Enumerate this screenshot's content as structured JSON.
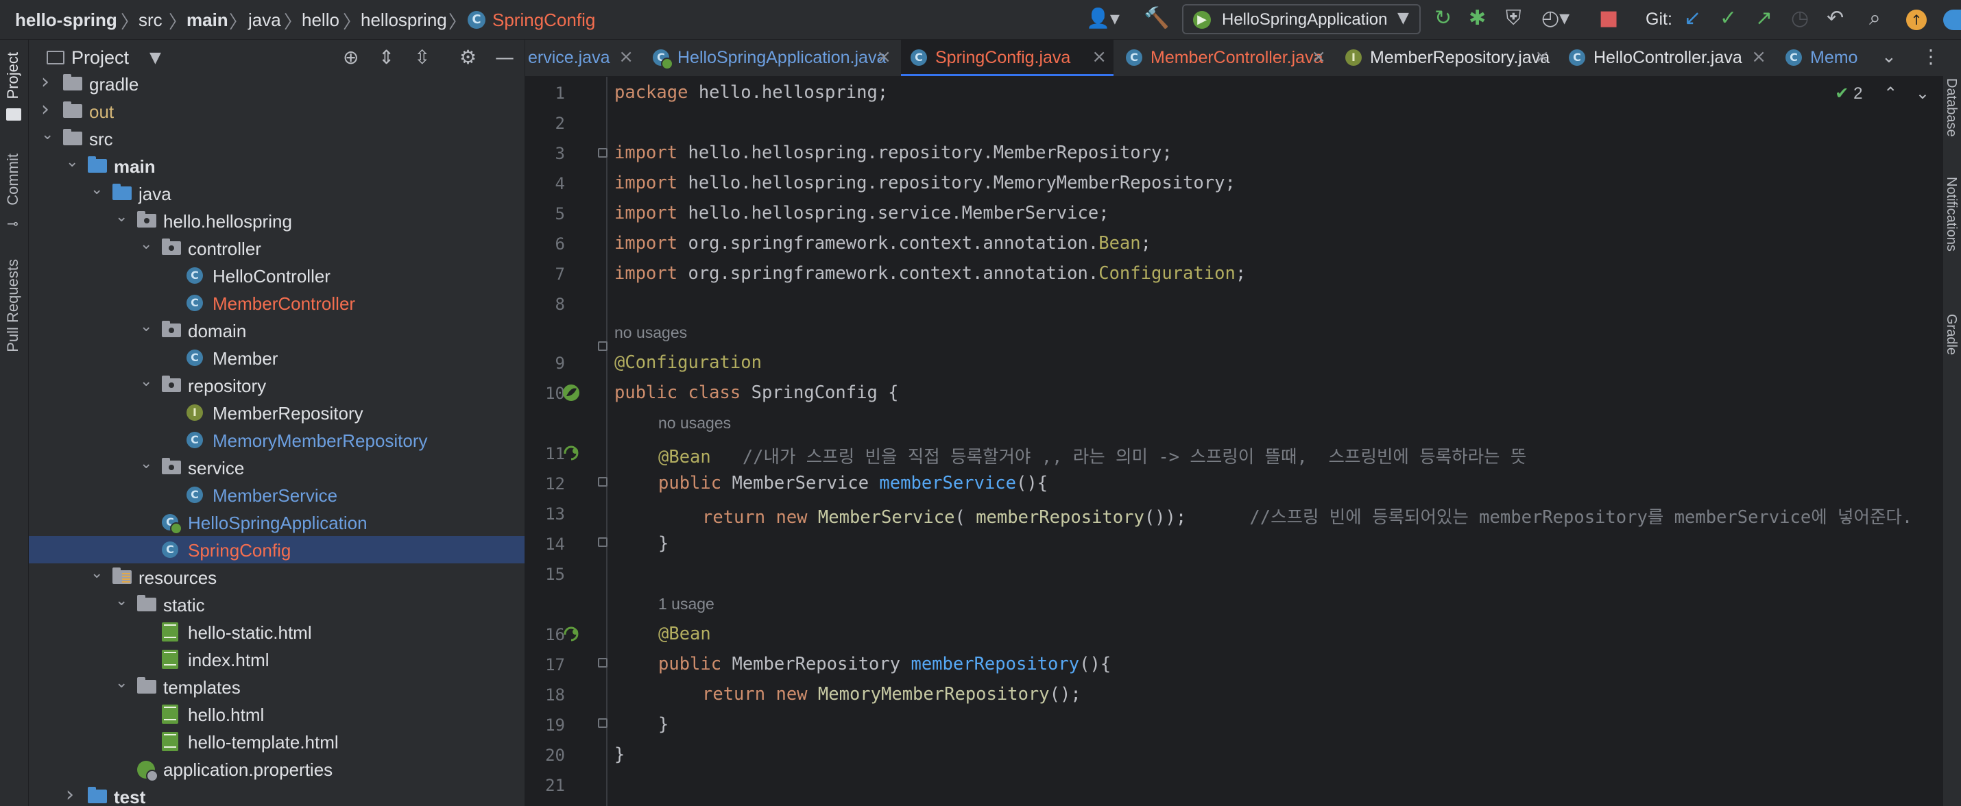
{
  "breadcrumb": [
    "hello-spring",
    "src",
    "main",
    "java",
    "hello",
    "hellospring",
    "SpringConfig"
  ],
  "run_config": "HelloSpringApplication",
  "git_label": "Git:",
  "left_strip": {
    "project": "Project",
    "commit": "Commit",
    "pull_requests": "Pull Requests"
  },
  "project_panel": {
    "title": "Project",
    "tree": [
      {
        "label": "gradle",
        "kind": "folder",
        "depth": 1,
        "chevron": "right",
        "color": "#dfe1e5"
      },
      {
        "label": "out",
        "kind": "folder",
        "depth": 1,
        "chevron": "right",
        "color": "#d5b778"
      },
      {
        "label": "src",
        "kind": "folder",
        "depth": 1,
        "chevron": "down",
        "color": "#dfe1e5"
      },
      {
        "label": "main",
        "kind": "module",
        "depth": 2,
        "chevron": "down",
        "color": "#dfe1e5",
        "bold": true
      },
      {
        "label": "java",
        "kind": "src-folder",
        "depth": 3,
        "chevron": "down",
        "color": "#dfe1e5"
      },
      {
        "label": "hello.hellospring",
        "kind": "package",
        "depth": 4,
        "chevron": "down",
        "color": "#dfe1e5"
      },
      {
        "label": "controller",
        "kind": "package",
        "depth": 5,
        "chevron": "down",
        "color": "#dfe1e5"
      },
      {
        "label": "HelloController",
        "kind": "class",
        "depth": 6,
        "color": "#dfe1e5"
      },
      {
        "label": "MemberController",
        "kind": "class",
        "depth": 6,
        "color": "#f46e4f"
      },
      {
        "label": "domain",
        "kind": "package",
        "depth": 5,
        "chevron": "down",
        "color": "#dfe1e5"
      },
      {
        "label": "Member",
        "kind": "class",
        "depth": 6,
        "color": "#dfe1e5"
      },
      {
        "label": "repository",
        "kind": "package",
        "depth": 5,
        "chevron": "down",
        "color": "#dfe1e5"
      },
      {
        "label": "MemberRepository",
        "kind": "interface",
        "depth": 6,
        "color": "#dfe1e5"
      },
      {
        "label": "MemoryMemberRepository",
        "kind": "class",
        "depth": 6,
        "color": "#6c9fe0"
      },
      {
        "label": "service",
        "kind": "package",
        "depth": 5,
        "chevron": "down",
        "color": "#dfe1e5"
      },
      {
        "label": "MemberService",
        "kind": "class",
        "depth": 6,
        "color": "#6c9fe0"
      },
      {
        "label": "HelloSpringApplication",
        "kind": "spring-class",
        "depth": 5,
        "color": "#6c9fe0"
      },
      {
        "label": "SpringConfig",
        "kind": "class",
        "depth": 5,
        "color": "#f46e4f",
        "selected": true
      },
      {
        "label": "resources",
        "kind": "res-folder",
        "depth": 3,
        "chevron": "down",
        "color": "#dfe1e5"
      },
      {
        "label": "static",
        "kind": "folder",
        "depth": 4,
        "chevron": "down",
        "color": "#dfe1e5"
      },
      {
        "label": "hello-static.html",
        "kind": "html",
        "depth": 5,
        "color": "#dfe1e5"
      },
      {
        "label": "index.html",
        "kind": "html",
        "depth": 5,
        "color": "#dfe1e5"
      },
      {
        "label": "templates",
        "kind": "folder",
        "depth": 4,
        "chevron": "down",
        "color": "#dfe1e5"
      },
      {
        "label": "hello.html",
        "kind": "html",
        "depth": 5,
        "color": "#dfe1e5"
      },
      {
        "label": "hello-template.html",
        "kind": "html",
        "depth": 5,
        "color": "#dfe1e5"
      },
      {
        "label": "application.properties",
        "kind": "properties",
        "depth": 4,
        "color": "#dfe1e5"
      },
      {
        "label": "test",
        "kind": "module",
        "depth": 2,
        "chevron": "right",
        "color": "#dfe1e5",
        "bold": true
      }
    ]
  },
  "tabs": [
    {
      "label": "ervice.java",
      "icon": "none",
      "color": "#6c9fe0",
      "active": false
    },
    {
      "label": "HelloSpringApplication.java",
      "icon": "spring-class",
      "color": "#6c9fe0",
      "active": false
    },
    {
      "label": "SpringConfig.java",
      "icon": "class",
      "color": "#f46e4f",
      "active": true
    },
    {
      "label": "MemberController.java",
      "icon": "class",
      "color": "#f46e4f",
      "active": false
    },
    {
      "label": "MemberRepository.java",
      "icon": "interface",
      "color": "#dfe1e5",
      "active": false
    },
    {
      "label": "HelloController.java",
      "icon": "class",
      "color": "#dfe1e5",
      "active": false
    },
    {
      "label": "Memo",
      "icon": "class",
      "color": "#6c9fe0",
      "active": false
    }
  ],
  "editor": {
    "inspection_count": "2",
    "lines": [
      "1",
      "2",
      "3",
      "4",
      "5",
      "6",
      "7",
      "8",
      "9",
      "10",
      "11",
      "12",
      "13",
      "14",
      "15",
      "16",
      "17",
      "18",
      "19",
      "20",
      "21"
    ],
    "hints": {
      "class_usages": "no usages",
      "member_service_usages": "no usages",
      "member_repository_usages": "1 usage"
    },
    "code": {
      "l1_kw": "package",
      "l1_rest": " hello.hellospring;",
      "l3_kw": "import",
      "l3_rest": " hello.hellospring.repository.MemberRepository;",
      "l4_kw": "import",
      "l4_rest": " hello.hellospring.repository.MemoryMemberRepository;",
      "l5_kw": "import",
      "l5_rest": " hello.hellospring.service.MemberService;",
      "l6_kw": "import",
      "l6_pre": " org.springframework.context.annotation.",
      "l6_cls": "Bean",
      "l6_end": ";",
      "l7_kw": "import",
      "l7_pre": " org.springframework.context.annotation.",
      "l7_cls": "Configuration",
      "l7_end": ";",
      "l9_ann": "@Configuration",
      "l10_kw": "public class",
      "l10_rest": " SpringConfig {",
      "l11_ann": "@Bean",
      "l11_cmt": "   //내가 스프링 빈을 직접 등록할거야 ,, 라는 의미 -> 스프링이 뜰때,  스프링빈에 등록하라는 뜻",
      "l12_kw": "public",
      "l12_type": " MemberService ",
      "l12_fn": "memberService",
      "l12_end": "(){",
      "l13_kw": "return new",
      "l13_type": " MemberService",
      "l13_mid": "( ",
      "l13_fn": "memberRepository",
      "l13_end": "());",
      "l13_cmt": "      //스프링 빈에 등록되어있는 memberRepository를 memberService에 넣어준다.",
      "l14": "}",
      "l16_ann": "@Bean",
      "l17_kw": "public",
      "l17_type": " MemberRepository ",
      "l17_fn": "memberRepository",
      "l17_end": "(){",
      "l18_kw": "return new",
      "l18_type": " MemoryMemberRepository",
      "l18_end": "();",
      "l19": "}",
      "l20": "}"
    }
  },
  "right_strip": {
    "database": "Database",
    "notifications": "Notifications",
    "gradle": "Gradle"
  }
}
